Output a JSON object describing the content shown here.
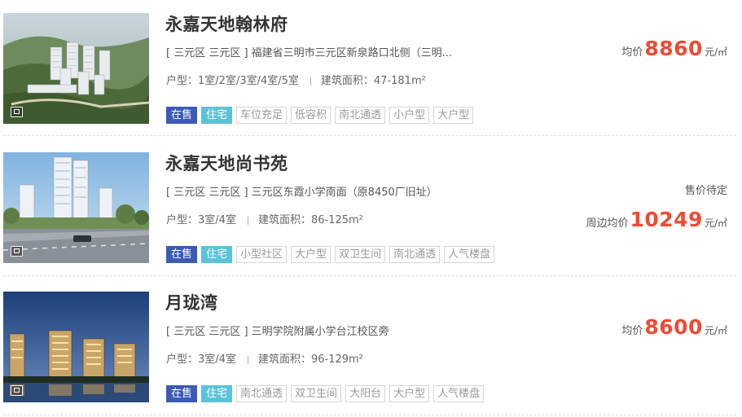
{
  "listings": [
    {
      "name": "永嘉天地翰林府",
      "address": "[ 三元区 三元区 ] 福建省三明市三元区新泉路口北侧（三明...",
      "layout_label": "户型：",
      "layout_value": "1室/2室/3室/4室/5室",
      "area_label": "建筑面积：",
      "area_value": "47-181m²",
      "status": "在售",
      "property_type": "住宅",
      "features": [
        "车位充足",
        "低容积",
        "南北通透",
        "小户型",
        "大户型"
      ],
      "price_note": "",
      "price_label": "均价",
      "price_value": "8860",
      "price_unit": "元/㎡"
    },
    {
      "name": "永嘉天地尚书苑",
      "address": "[ 三元区 三元区 ] 三元区东霞小学南面（原8450厂旧址）",
      "layout_label": "户型：",
      "layout_value": "3室/4室",
      "area_label": "建筑面积：",
      "area_value": "86-125m²",
      "status": "在售",
      "property_type": "住宅",
      "features": [
        "小型社区",
        "大户型",
        "双卫生间",
        "南北通透",
        "人气楼盘"
      ],
      "price_note": "售价待定",
      "price_label": "周边均价",
      "price_value": "10249",
      "price_unit": "元/㎡"
    },
    {
      "name": "月珑湾",
      "address": "[ 三元区 三元区 ] 三明学院附属小学台江校区旁",
      "layout_label": "户型：",
      "layout_value": "3室/4室",
      "area_label": "建筑面积：",
      "area_value": "96-129m²",
      "status": "在售",
      "property_type": "住宅",
      "features": [
        "南北通透",
        "双卫生间",
        "大阳台",
        "大户型",
        "人气楼盘"
      ],
      "price_note": "",
      "price_label": "均价",
      "price_value": "8600",
      "price_unit": "元/㎡"
    }
  ],
  "colors": {
    "status_tag": "#3b5bb5",
    "type_tag": "#5bc2d8",
    "price": "#ee4b33"
  },
  "icons": {
    "photo_badge": "gallery-icon"
  }
}
